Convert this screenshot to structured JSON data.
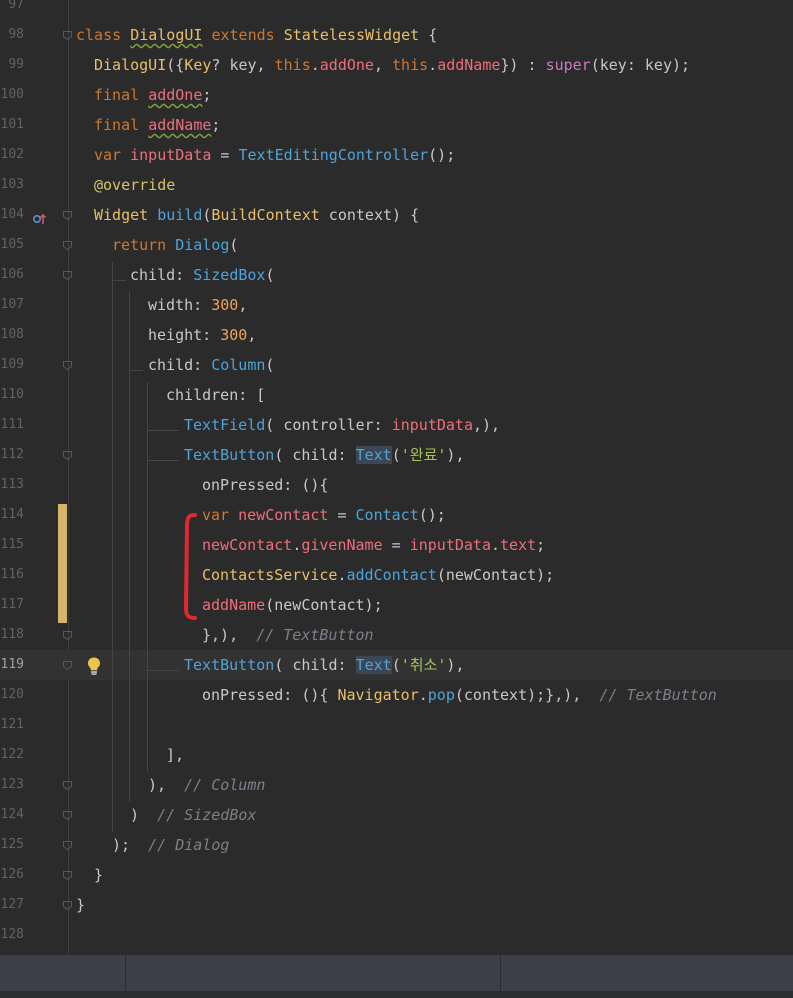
{
  "editor": {
    "lines": [
      {
        "n": "97",
        "tokens": []
      },
      {
        "n": "98",
        "tokens": [
          [
            "class ",
            "kw"
          ],
          [
            "DialogUI",
            "class"
          ],
          [
            " extends ",
            "kw"
          ],
          [
            "StatelessWidget",
            "class"
          ],
          [
            " {",
            "plain"
          ]
        ]
      },
      {
        "n": "99",
        "tokens": [
          [
            "DialogUI",
            "class"
          ],
          [
            "({",
            "plain"
          ],
          [
            "Key",
            "class"
          ],
          [
            "? key, ",
            "plain"
          ],
          [
            "this",
            "kw"
          ],
          [
            ".",
            "plain"
          ],
          [
            "addOne",
            "red"
          ],
          [
            ", ",
            "plain"
          ],
          [
            "this",
            "kw"
          ],
          [
            ".",
            "plain"
          ],
          [
            "addName",
            "red"
          ],
          [
            "}) : ",
            "plain"
          ],
          [
            "super",
            "purple"
          ],
          [
            "(key: key);",
            "plain"
          ]
        ]
      },
      {
        "n": "100",
        "tokens": [
          [
            "final ",
            "kw"
          ],
          [
            "addOne",
            "red"
          ],
          [
            ";",
            "plain"
          ]
        ]
      },
      {
        "n": "101",
        "tokens": [
          [
            "final ",
            "kw"
          ],
          [
            "addName",
            "red"
          ],
          [
            ";",
            "plain"
          ]
        ]
      },
      {
        "n": "102",
        "tokens": [
          [
            "var ",
            "kw"
          ],
          [
            "inputData",
            "red"
          ],
          [
            " = ",
            "plain"
          ],
          [
            "TextEditingController",
            "blue"
          ],
          [
            "();",
            "plain"
          ]
        ]
      },
      {
        "n": "103",
        "tokens": [
          [
            "@override",
            "yellow"
          ]
        ]
      },
      {
        "n": "104",
        "tokens": [
          [
            "Widget ",
            "class"
          ],
          [
            "build",
            "blue"
          ],
          [
            "(",
            "plain"
          ],
          [
            "BuildContext",
            "class"
          ],
          [
            " context) {",
            "plain"
          ]
        ]
      },
      {
        "n": "105",
        "tokens": [
          [
            "return ",
            "kw"
          ],
          [
            "Dialog",
            "blue"
          ],
          [
            "(",
            "plain"
          ]
        ]
      },
      {
        "n": "106",
        "tokens": [
          [
            "child: ",
            "plain"
          ],
          [
            "SizedBox",
            "blue"
          ],
          [
            "(",
            "plain"
          ]
        ]
      },
      {
        "n": "107",
        "tokens": [
          [
            "width: ",
            "plain"
          ],
          [
            "300",
            "orange"
          ],
          [
            ",",
            "plain"
          ]
        ]
      },
      {
        "n": "108",
        "tokens": [
          [
            "height: ",
            "plain"
          ],
          [
            "300",
            "orange"
          ],
          [
            ",",
            "plain"
          ]
        ]
      },
      {
        "n": "109",
        "tokens": [
          [
            "child: ",
            "plain"
          ],
          [
            "Column",
            "blue"
          ],
          [
            "(",
            "plain"
          ]
        ]
      },
      {
        "n": "110",
        "tokens": [
          [
            "children: [",
            "plain"
          ]
        ]
      },
      {
        "n": "111",
        "tokens": [
          [
            "TextField",
            "blue"
          ],
          [
            "( controller: ",
            "plain"
          ],
          [
            "inputData",
            "red"
          ],
          [
            ",),",
            "plain"
          ]
        ]
      },
      {
        "n": "112",
        "tokens": [
          [
            "TextButton",
            "blue"
          ],
          [
            "( child: ",
            "plain"
          ],
          [
            "Text",
            "blue"
          ],
          [
            "(",
            "plain"
          ],
          [
            "'완료'",
            "green"
          ],
          [
            "),",
            "plain"
          ]
        ]
      },
      {
        "n": "113",
        "tokens": [
          [
            "onPressed: (){",
            "plain"
          ]
        ]
      },
      {
        "n": "114",
        "tokens": [
          [
            "var ",
            "kw"
          ],
          [
            "newContact",
            "red"
          ],
          [
            " = ",
            "plain"
          ],
          [
            "Contact",
            "blue"
          ],
          [
            "();",
            "plain"
          ]
        ]
      },
      {
        "n": "115",
        "tokens": [
          [
            "newContact",
            "red"
          ],
          [
            ".",
            "plain"
          ],
          [
            "givenName",
            "red"
          ],
          [
            " = ",
            "plain"
          ],
          [
            "inputData",
            "red"
          ],
          [
            ".",
            "plain"
          ],
          [
            "text",
            "red"
          ],
          [
            ";",
            "plain"
          ]
        ]
      },
      {
        "n": "116",
        "tokens": [
          [
            "ContactsService",
            "class"
          ],
          [
            ".",
            "plain"
          ],
          [
            "addContact",
            "blue"
          ],
          [
            "(newContact);",
            "plain"
          ]
        ]
      },
      {
        "n": "117",
        "tokens": [
          [
            "addName",
            "red"
          ],
          [
            "(newContact);",
            "plain"
          ]
        ]
      },
      {
        "n": "118",
        "tokens": [
          [
            "},),  ",
            "plain"
          ],
          [
            "// TextButton",
            "gray"
          ]
        ]
      },
      {
        "n": "119",
        "tokens": [
          [
            "TextButton",
            "blue"
          ],
          [
            "( child: ",
            "plain"
          ],
          [
            "Text",
            "blue"
          ],
          [
            "(",
            "plain"
          ],
          [
            "'취소'",
            "green"
          ],
          [
            "),",
            "plain"
          ]
        ]
      },
      {
        "n": "120",
        "tokens": [
          [
            "onPressed: (){ ",
            "plain"
          ],
          [
            "Navigator",
            "class"
          ],
          [
            ".",
            "plain"
          ],
          [
            "pop",
            "blue"
          ],
          [
            "(context);},),  ",
            "plain"
          ],
          [
            "// TextButton",
            "gray"
          ]
        ]
      },
      {
        "n": "121",
        "tokens": []
      },
      {
        "n": "122",
        "tokens": [
          [
            "],",
            "plain"
          ]
        ]
      },
      {
        "n": "123",
        "tokens": [
          [
            "),  ",
            "plain"
          ],
          [
            "// Column",
            "gray"
          ]
        ]
      },
      {
        "n": "124",
        "tokens": [
          [
            ")  ",
            "plain"
          ],
          [
            "// SizedBox",
            "gray"
          ]
        ]
      },
      {
        "n": "125",
        "tokens": [
          [
            ");  ",
            "plain"
          ],
          [
            "// Dialog",
            "gray"
          ]
        ]
      },
      {
        "n": "126",
        "tokens": [
          [
            "}",
            "plain"
          ]
        ]
      },
      {
        "n": "127",
        "tokens": [
          [
            "}",
            "plain"
          ]
        ]
      },
      {
        "n": "128",
        "tokens": []
      }
    ],
    "current_line": "119",
    "colors": {
      "background": "#2b2b2b",
      "current_line": "#323232",
      "change_marker": "#d7b56d",
      "bracket_annotation": "#e0282e"
    }
  },
  "status_bar": {}
}
